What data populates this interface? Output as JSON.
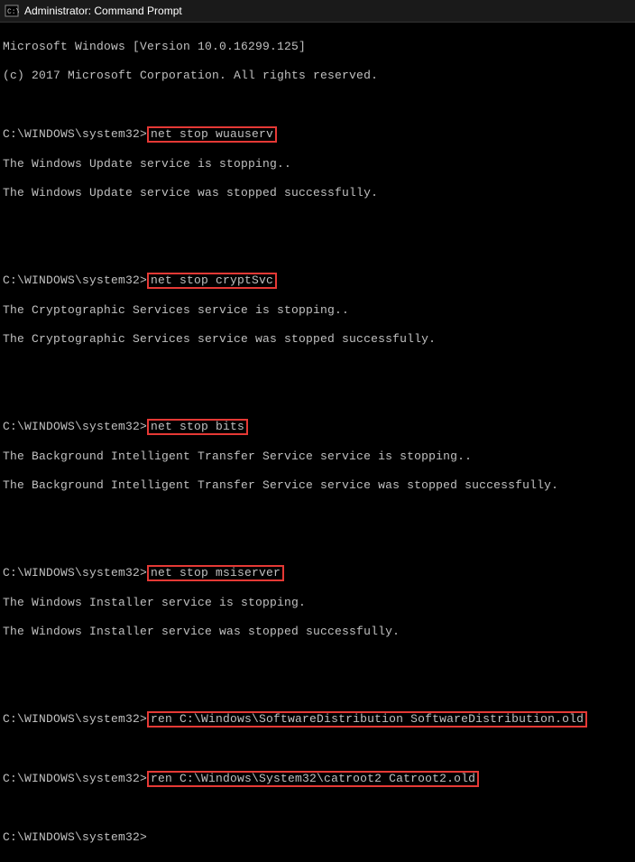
{
  "titlebar": {
    "icon_name": "cmd-icon",
    "title": "Administrator: Command Prompt"
  },
  "prompt": "C:\\WINDOWS\\system32>",
  "header": {
    "line1": "Microsoft Windows [Version 10.0.16299.125]",
    "line2": "(c) 2017 Microsoft Corporation. All rights reserved."
  },
  "blocks": [
    {
      "cmd": "net stop wuauserv",
      "out1": "The Windows Update service is stopping..",
      "out2": "The Windows Update service was stopped successfully."
    },
    {
      "cmd": "net stop cryptSvc",
      "out1": "The Cryptographic Services service is stopping..",
      "out2": "The Cryptographic Services service was stopped successfully."
    },
    {
      "cmd": "net stop bits",
      "out1": "The Background Intelligent Transfer Service service is stopping..",
      "out2": "The Background Intelligent Transfer Service service was stopped successfully."
    },
    {
      "cmd": "net stop msiserver",
      "out1": "The Windows Installer service is stopping.",
      "out2": "The Windows Installer service was stopped successfully."
    }
  ],
  "rename_cmds": [
    "ren C:\\Windows\\SoftwareDistribution SoftwareDistribution.old",
    "ren C:\\Windows\\System32\\catroot2 Catroot2.old"
  ],
  "highlight_color": "#e53935"
}
